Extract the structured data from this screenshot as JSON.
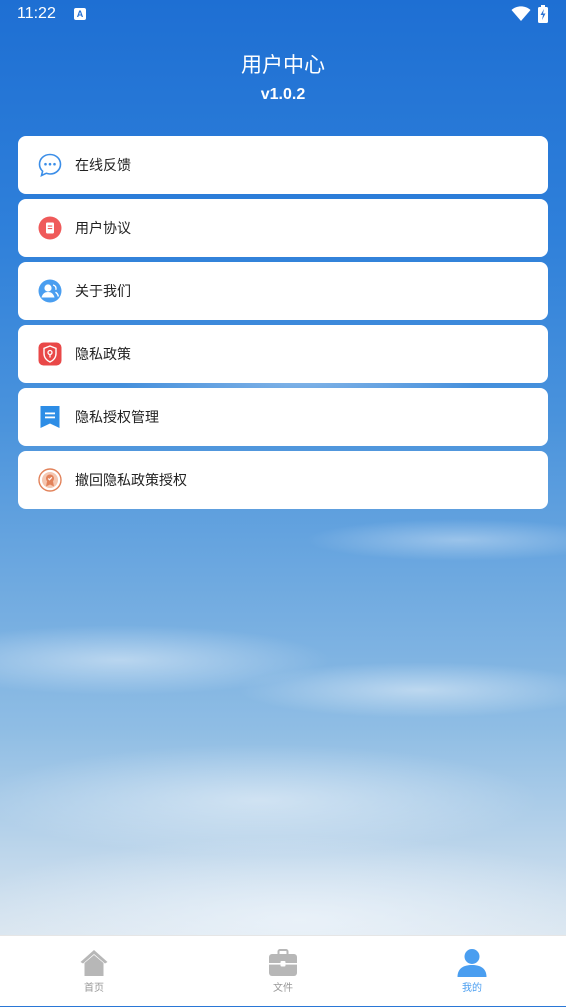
{
  "status_bar": {
    "time": "11:22",
    "notification_icon": "A"
  },
  "header": {
    "title": "用户中心",
    "version": "v1.0.2"
  },
  "menu": {
    "items": [
      {
        "label": "在线反馈",
        "icon": "chat-bubble-icon",
        "color": "#3b8ee8"
      },
      {
        "label": "用户协议",
        "icon": "document-icon",
        "color": "#ef5a5a"
      },
      {
        "label": "关于我们",
        "icon": "users-icon",
        "color": "#4a9ef0"
      },
      {
        "label": "隐私政策",
        "icon": "shield-icon",
        "color": "#e94848"
      },
      {
        "label": "隐私授权管理",
        "icon": "bookmark-list-icon",
        "color": "#2d8de6"
      },
      {
        "label": "撤回隐私政策授权",
        "icon": "badge-icon",
        "color": "#e2825a"
      }
    ]
  },
  "tabbar": {
    "tabs": [
      {
        "label": "首页",
        "icon": "home-icon",
        "active": false
      },
      {
        "label": "文件",
        "icon": "briefcase-icon",
        "active": false
      },
      {
        "label": "我的",
        "icon": "person-icon",
        "active": true
      }
    ],
    "active_color": "#4a9ef0",
    "inactive_color": "#b7b7b7"
  }
}
